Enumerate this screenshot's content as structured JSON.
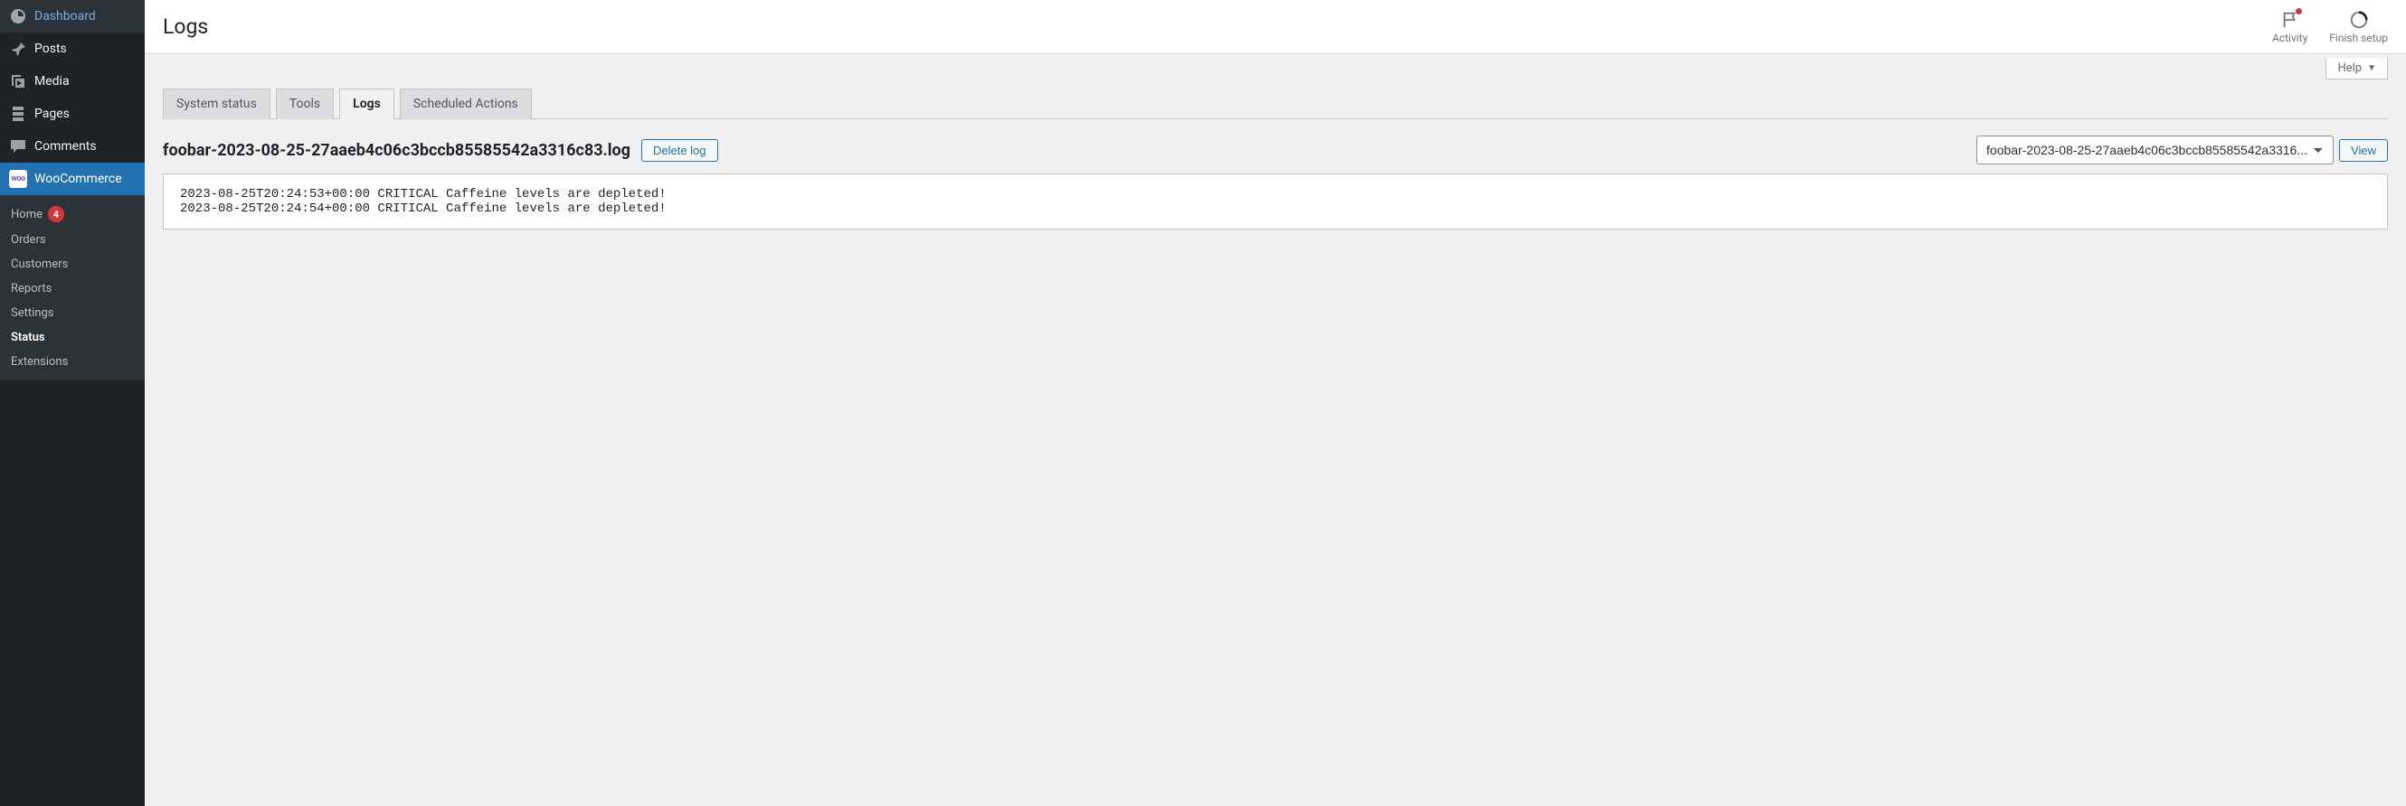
{
  "sidebar": {
    "items": [
      {
        "label": "Dashboard",
        "icon": "dashboard-icon"
      },
      {
        "label": "Posts",
        "icon": "pin-icon"
      },
      {
        "label": "Media",
        "icon": "media-icon"
      },
      {
        "label": "Pages",
        "icon": "page-icon"
      },
      {
        "label": "Comments",
        "icon": "comment-icon"
      },
      {
        "label": "WooCommerce",
        "icon": "woo-icon",
        "active": true
      }
    ],
    "submenu": [
      {
        "label": "Home",
        "badge": "4"
      },
      {
        "label": "Orders"
      },
      {
        "label": "Customers"
      },
      {
        "label": "Reports"
      },
      {
        "label": "Settings"
      },
      {
        "label": "Status",
        "current": true
      },
      {
        "label": "Extensions"
      }
    ]
  },
  "header": {
    "title": "Logs",
    "activity_label": "Activity",
    "finish_setup_label": "Finish setup",
    "help_label": "Help"
  },
  "tabs": [
    {
      "label": "System status"
    },
    {
      "label": "Tools"
    },
    {
      "label": "Logs",
      "active": true
    },
    {
      "label": "Scheduled Actions"
    }
  ],
  "log": {
    "title": "foobar-2023-08-25-27aaeb4c06c3bccb85585542a3316c83.log",
    "delete_label": "Delete log",
    "select_value": "foobar-2023-08-25-27aaeb4c06c3bccb85585542a3316...",
    "view_label": "View",
    "content": "2023-08-25T20:24:53+00:00 CRITICAL Caffeine levels are depleted!\n2023-08-25T20:24:54+00:00 CRITICAL Caffeine levels are depleted!"
  }
}
